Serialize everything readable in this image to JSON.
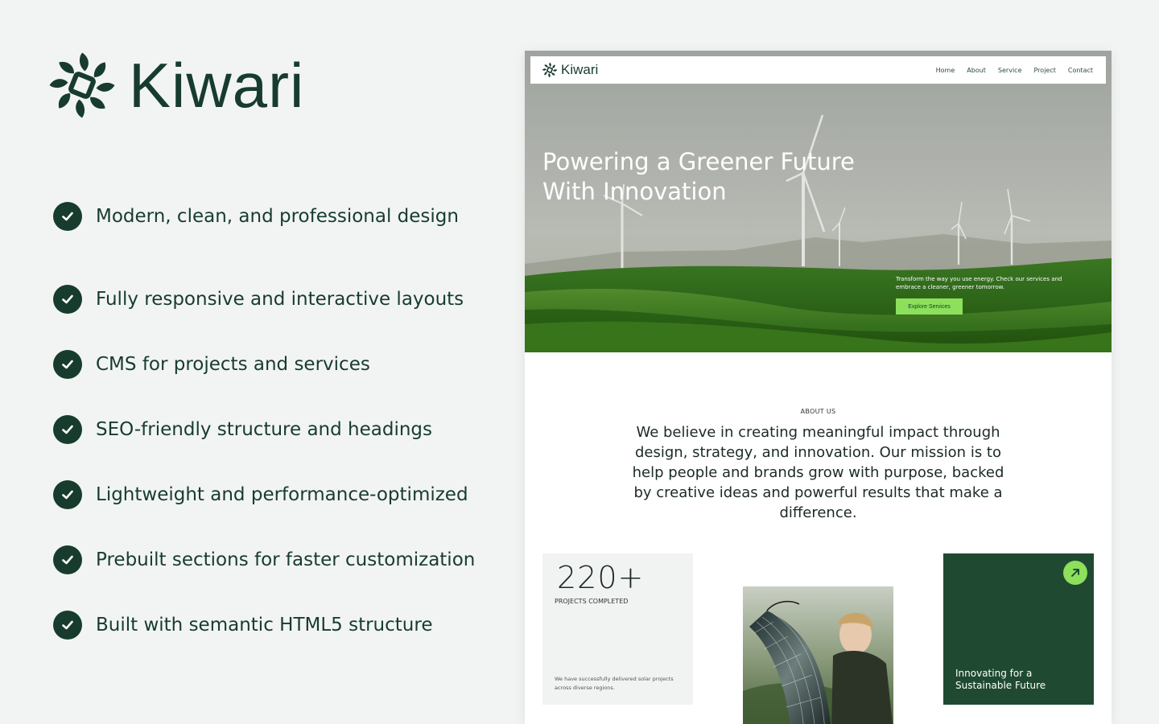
{
  "brand": {
    "name": "Kiwari",
    "logo_icon": "leaf-swirl-icon",
    "color": "#173c2e"
  },
  "features": [
    {
      "text": "Modern, clean, and professional design"
    },
    {
      "text": "Fully responsive and interactive layouts"
    },
    {
      "text": "CMS for projects and services"
    },
    {
      "text": "SEO-friendly structure and headings"
    },
    {
      "text": "Lightweight and performance-optimized"
    },
    {
      "text": "Prebuilt sections for faster customization"
    },
    {
      "text": "Built with semantic HTML5 structure"
    }
  ],
  "preview": {
    "nav": {
      "brand": "Kiwari",
      "links": [
        "Home",
        "About",
        "Service",
        "Project",
        "Contact"
      ]
    },
    "hero": {
      "title": "Powering a Greener Future With Innovation",
      "description": "Transform the way you use energy. Check our services and embrace a cleaner, greener tomorrow.",
      "button_label": "Explore Services",
      "accent": "#8ce05b"
    },
    "about": {
      "label": "ABOUT US",
      "text": "We believe in creating meaningful impact through design, strategy, and innovation. Our mission is to help people and brands grow with purpose, backed by creative ideas and powerful results that make a difference."
    },
    "stat": {
      "value": "220+",
      "label": "PROJECTS COMPLETED",
      "description": "We have successfully delivered solar projects across diverse regions."
    },
    "green_card": {
      "text": "Innovating for a Sustainable Future",
      "icon": "arrow-up-right-icon",
      "color": "#1f4a31"
    }
  }
}
